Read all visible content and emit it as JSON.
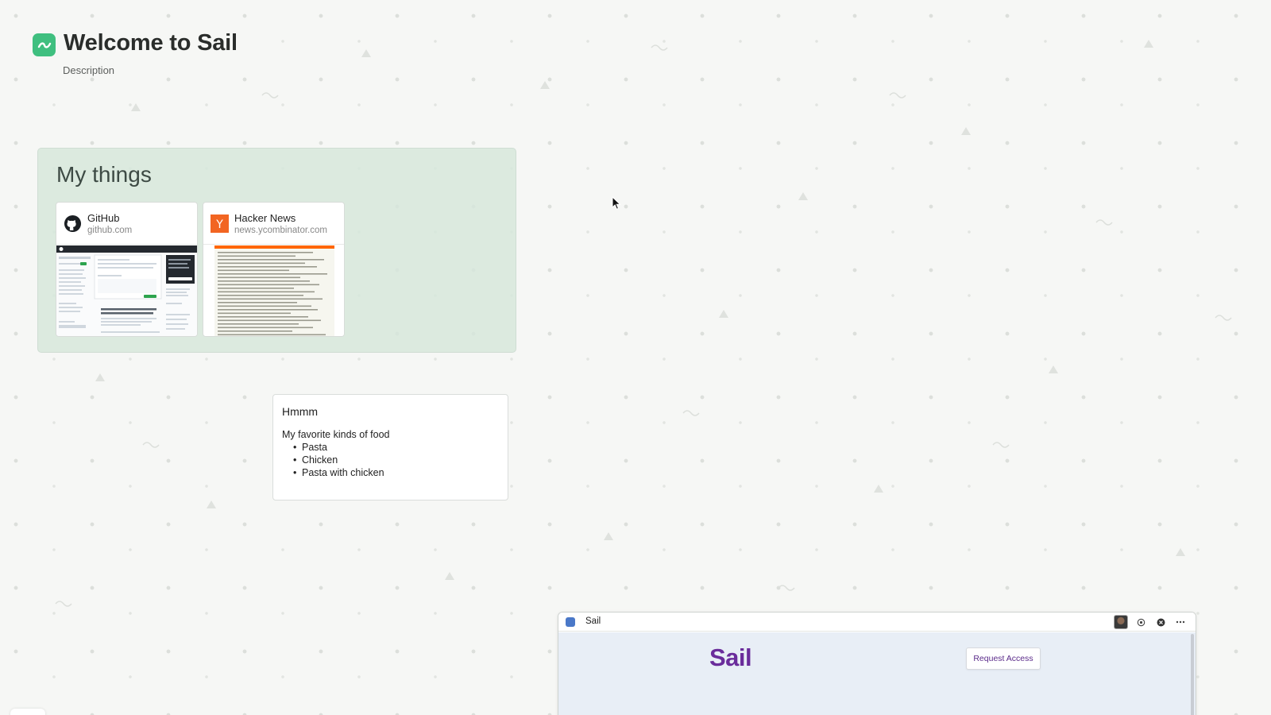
{
  "space": {
    "title": "Welcome to Sail",
    "description": "Description",
    "logo_color": "#3fbf7f"
  },
  "group": {
    "title": "My things",
    "cards": [
      {
        "title": "GitHub",
        "domain": "github.com",
        "icon": "github-icon"
      },
      {
        "title": "Hacker News",
        "domain": "news.ycombinator.com",
        "icon": "hacker-news-icon"
      }
    ]
  },
  "note": {
    "title": "Hmmm",
    "intro": "My favorite kinds of food",
    "items": [
      "Pasta",
      "Chicken",
      "Pasta with chicken"
    ]
  },
  "embed": {
    "title": "Sail",
    "wordmark": "Sail",
    "request_label": "Request Access",
    "brand_color": "#6a2c9b"
  }
}
